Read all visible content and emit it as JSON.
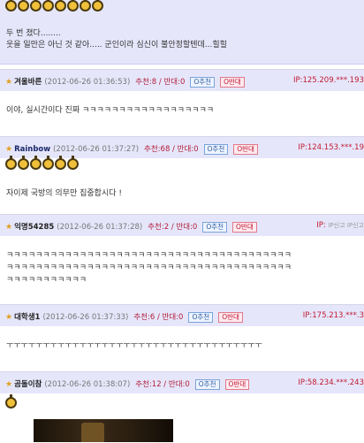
{
  "top": {
    "line1": "두 번 졌다........",
    "line2": "웃을 일만은 아닌 것 같아..... 군인이라 심신이 불안정할텐데...힐힐"
  },
  "comments": [
    {
      "nick": "겨울바른",
      "date": "(2012-06-26 01:36:53)",
      "votes": "추천:8 / 반대:0",
      "ip": "IP:125.209.***.193",
      "text": "이야, 실시간이다 진짜 ㅋㅋㅋㅋㅋㅋㅋㅋㅋㅋㅋㅋㅋㅋㅋㅋㅋㅋ"
    },
    {
      "nick": "Rainbow",
      "date": "(2012-06-26 01:37:27)",
      "votes": "추천:68 / 반대:0",
      "ip": "IP:124.153.***.19",
      "text": "자이제 국방의 의무만 집중합시다 !"
    },
    {
      "nick": "익명54285",
      "date": "(2012-06-26 01:37:28)",
      "votes": "추천:2 / 반대:0",
      "ip": "IP:",
      "ip_note": "IP신고   IP신고",
      "lines": [
        "ㅋㅋㅋㅋㅋㅋㅋㅋㅋㅋㅋㅋㅋㅋㅋㅋㅋㅋㅋㅋㅋㅋㅋㅋㅋㅋㅋㅋㅋㅋㅋㅋㅋㅋㅋㅋㅋㅋㅋ",
        "ㅋㅋㅋㅋㅋㅋㅋㅋㅋㅋㅋㅋㅋㅋㅋㅋㅋㅋㅋㅋㅋㅋㅋㅋㅋㅋㅋㅋㅋㅋㅋㅋㅋㅋㅋㅋㅋㅋㅋ",
        "ㅋㅋㅋㅋㅋㅋㅋㅋㅋㅋㅋ"
      ]
    },
    {
      "nick": "대학생1",
      "date": "(2012-06-26 01:37:33)",
      "votes": "추천:6 / 반대:0",
      "ip": "IP:175.213.***.3",
      "text": "ㅜㅜㅜㅜㅜㅜㅜㅜㅜㅜㅜㅜㅜㅜㅜㅜㅜㅜㅜㅜㅜㅜㅜㅜㅜㅜㅜㅜㅜㅜㅜㅜㅜㅜㅜ"
    },
    {
      "nick": "곰돌이참",
      "date": "(2012-06-26 01:38:07)",
      "votes": "추천:12 / 반대:0",
      "ip": "IP:58.234.***.243"
    }
  ],
  "buttons": {
    "recommend": "O추천",
    "oppose": "O반대"
  },
  "colors": {
    "header_bg": "#e6e6fb",
    "vote_red": "#b0203a",
    "rec_blue": "#2a5aa0"
  }
}
